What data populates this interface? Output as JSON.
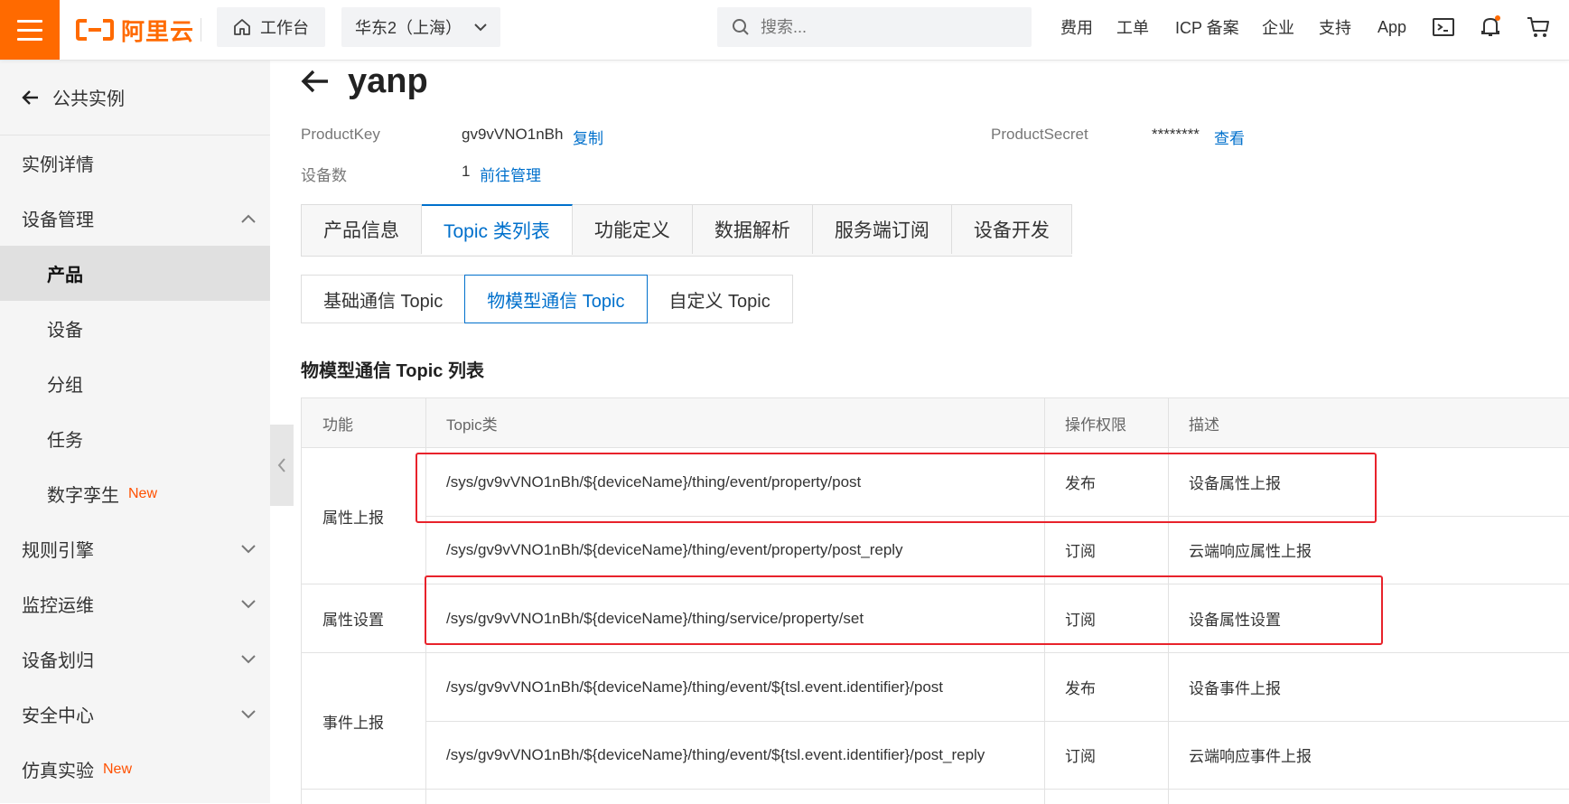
{
  "colors": {
    "brand": "#ff6a00",
    "link": "#0070cc",
    "new_badge": "#ff5000",
    "highlight": "#e8222b"
  },
  "header": {
    "logo_text": "阿里云",
    "workbench_label": "工作台",
    "region_label": "华东2（上海）",
    "search_placeholder": "搜索...",
    "nav": [
      "费用",
      "工单",
      "ICP 备案",
      "企业",
      "支持",
      "App"
    ]
  },
  "sidebar": {
    "back_label": "公共实例",
    "items": [
      {
        "label": "实例详情"
      },
      {
        "label": "设备管理"
      },
      {
        "label": "产品"
      },
      {
        "label": "设备"
      },
      {
        "label": "分组"
      },
      {
        "label": "任务"
      },
      {
        "label": "数字孪生",
        "badge": "New"
      },
      {
        "label": "规则引擎"
      },
      {
        "label": "监控运维"
      },
      {
        "label": "设备划归"
      },
      {
        "label": "安全中心"
      },
      {
        "label": "仿真实验",
        "badge": "New"
      }
    ]
  },
  "product": {
    "name": "yanp",
    "product_key_label": "ProductKey",
    "product_key": "gv9vVNO1nBh",
    "copy_label": "复制",
    "product_secret_label": "ProductSecret",
    "product_secret": "********",
    "view_label": "查看",
    "device_count_label": "设备数",
    "device_count": "1",
    "manage_label": "前往管理"
  },
  "tabs": [
    "产品信息",
    "Topic 类列表",
    "功能定义",
    "数据解析",
    "服务端订阅",
    "设备开发"
  ],
  "subtabs": [
    "基础通信 Topic",
    "物模型通信 Topic",
    "自定义 Topic"
  ],
  "section_title": "物模型通信 Topic 列表",
  "table": {
    "headers": [
      "功能",
      "Topic类",
      "操作权限",
      "描述"
    ],
    "groups": [
      "属性上报",
      "属性设置",
      "事件上报"
    ],
    "rows": [
      {
        "topic": "/sys/gv9vVNO1nBh/${deviceName}/thing/event/property/post",
        "perm": "发布",
        "desc": "设备属性上报"
      },
      {
        "topic": "/sys/gv9vVNO1nBh/${deviceName}/thing/event/property/post_reply",
        "perm": "订阅",
        "desc": "云端响应属性上报"
      },
      {
        "topic": "/sys/gv9vVNO1nBh/${deviceName}/thing/service/property/set",
        "perm": "订阅",
        "desc": "设备属性设置"
      },
      {
        "topic": "/sys/gv9vVNO1nBh/${deviceName}/thing/event/${tsl.event.identifier}/post",
        "perm": "发布",
        "desc": "设备事件上报"
      },
      {
        "topic": "/sys/gv9vVNO1nBh/${deviceName}/thing/event/${tsl.event.identifier}/post_reply",
        "perm": "订阅",
        "desc": "云端响应事件上报"
      }
    ]
  }
}
